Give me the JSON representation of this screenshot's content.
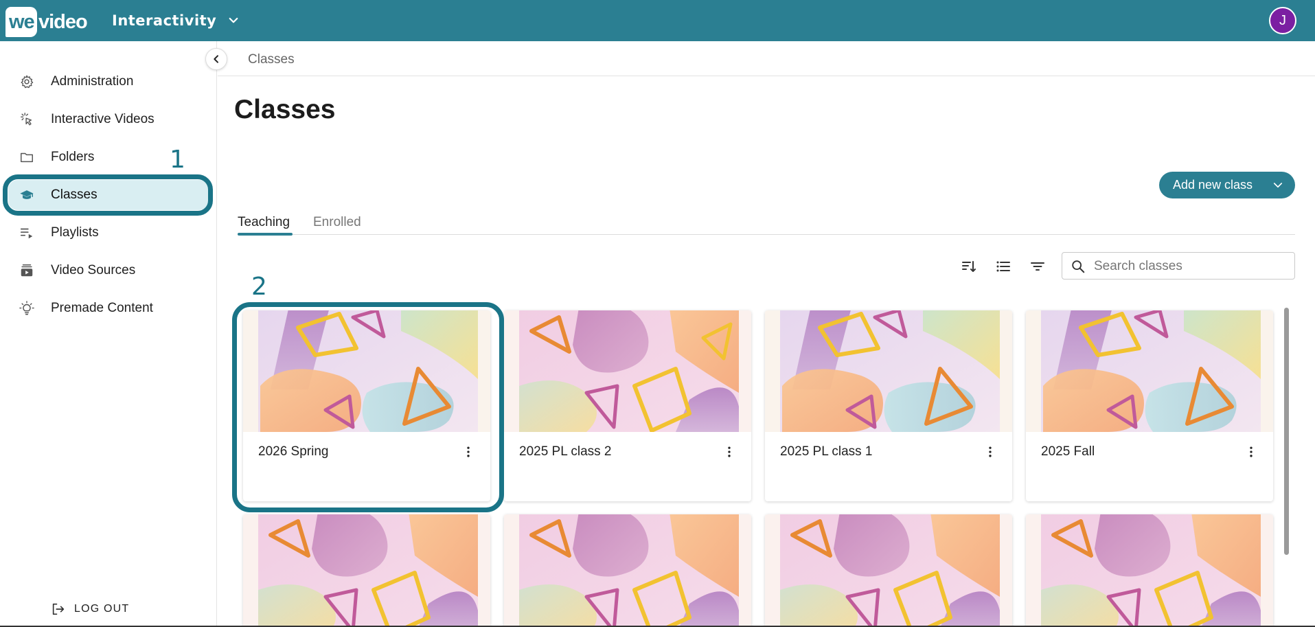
{
  "brand": {
    "logo_we": "we",
    "logo_video": "video",
    "accent": "#2b7f92",
    "highlight": "#1a7487"
  },
  "header": {
    "app_name": "Interactivity",
    "avatar_initial": "J",
    "avatar_color": "#7b1fa2"
  },
  "sidebar": {
    "items": [
      {
        "label": "Administration",
        "icon": "gear-icon"
      },
      {
        "label": "Interactive Videos",
        "icon": "click-pointer-icon"
      },
      {
        "label": "Folders",
        "icon": "folder-icon"
      },
      {
        "label": "Classes",
        "icon": "graduation-cap-icon",
        "active": true
      },
      {
        "label": "Playlists",
        "icon": "playlist-icon"
      },
      {
        "label": "Video Sources",
        "icon": "video-library-icon"
      },
      {
        "label": "Premade Content",
        "icon": "lightbulb-icon"
      }
    ],
    "logout_label": "LOG OUT"
  },
  "annotations": {
    "step1": "1",
    "step2": "2"
  },
  "breadcrumb": "Classes",
  "page_title": "Classes",
  "add_button": {
    "label": "Add new class"
  },
  "tabs": [
    {
      "label": "Teaching",
      "active": true
    },
    {
      "label": "Enrolled",
      "active": false
    }
  ],
  "toolbar": {
    "sort_icon": "sort-icon",
    "list_view_icon": "list-view-icon",
    "filter_icon": "filter-icon",
    "search_placeholder": "Search classes"
  },
  "classes": [
    {
      "name": "2026 Spring"
    },
    {
      "name": "2025 PL class 2"
    },
    {
      "name": "2025 PL class 1"
    },
    {
      "name": "2025 Fall"
    }
  ]
}
